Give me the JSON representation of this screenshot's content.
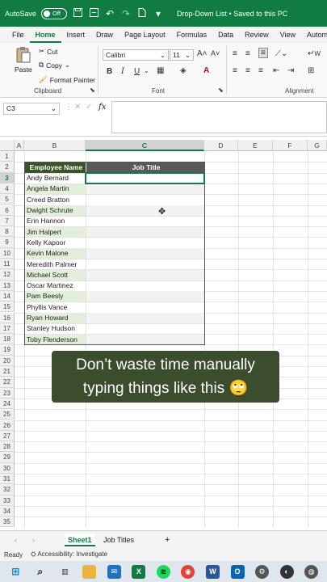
{
  "titlebar": {
    "autosave_label": "AutoSave",
    "autosave_state": "Off",
    "doc_title": "Drop-Down List • Saved to this PC",
    "save_icon": "save-icon",
    "undo_icon": "undo-icon"
  },
  "ribbon_tabs": [
    "File",
    "Home",
    "Insert",
    "Draw",
    "Page Layout",
    "Formulas",
    "Data",
    "Review",
    "View",
    "Automate"
  ],
  "ribbon": {
    "paste": "Paste",
    "cut": "Cut",
    "copy": "Copy",
    "format_painter": "Format Painter",
    "clipboard": "Clipboard",
    "font_name": "Calibri",
    "font_size": "11",
    "font_group": "Font",
    "bold": "B",
    "italic": "I",
    "underline": "U",
    "grow_font": "A˄",
    "shrink_font": "A˅",
    "alignment": "Alignment",
    "wrap": "W"
  },
  "formula_bar": {
    "name_box": "C3",
    "fx": "fx",
    "value": ""
  },
  "columns": [
    "A",
    "B",
    "C",
    "D",
    "E",
    "F",
    "G"
  ],
  "rows": [
    "1",
    "2",
    "3",
    "4",
    "5",
    "6",
    "7",
    "8",
    "9",
    "10",
    "11",
    "12",
    "13",
    "14",
    "15",
    "16",
    "17",
    "18",
    "19",
    "20",
    "21",
    "22",
    "23",
    "24",
    "25",
    "26",
    "27",
    "28",
    "29",
    "30",
    "31",
    "32",
    "33",
    "34",
    "35"
  ],
  "table": {
    "header_name": "Employee Name",
    "header_title": "Job Title",
    "employees": [
      "Andy Bernard",
      "Angela Martin",
      "Creed Bratton",
      "Dwight Schrute",
      "Erin Hannon",
      "Jim Halpert",
      "Kelly Kapoor",
      "Kevin Malone",
      "Meredith Palmer",
      "Michael Scott",
      "Oscar Martinez",
      "Pam Beesly",
      "Phyllis Vance",
      "Ryan Howard",
      "Stanley Hudson",
      "Toby Flenderson"
    ]
  },
  "caption": {
    "line1": "Don’t waste time manually",
    "line2": "typing things like this 🙄"
  },
  "sheets": {
    "active": "Sheet1",
    "other": "Job Titles",
    "add": "+"
  },
  "status": {
    "ready": "Ready",
    "accessibility": "Accessibility: Investigate"
  },
  "colors": {
    "excel_green": "#107c41",
    "header_green": "#375623",
    "header_gray": "#595959",
    "band_green": "#e2efda"
  }
}
